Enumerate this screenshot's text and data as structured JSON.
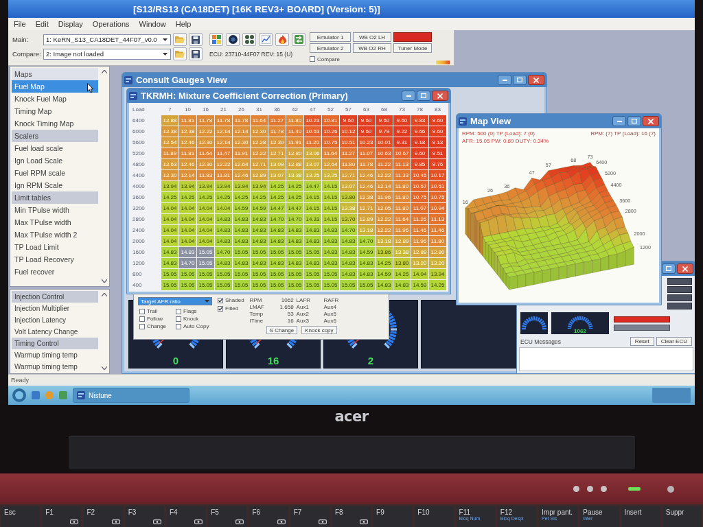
{
  "window": {
    "title": "[S13/RS13 (CA18DET) [16K REV3+ BOARD] (Version: 5)]"
  },
  "menu": [
    "File",
    "Edit",
    "Display",
    "Operations",
    "Window",
    "Help"
  ],
  "toolbar": {
    "main_label": "Main:",
    "main_image": "1: KeRN_S13_CA18DET_44F07_v0.0",
    "compare_label": "Compare:",
    "compare_image": "2: Image not loaded",
    "ecu": "ECU: 23710-44F07 REV: 15 (U)",
    "buttons": [
      {
        "kind": "button",
        "label": "Emulator 1"
      },
      {
        "kind": "button",
        "label": "WB O2 LH"
      },
      {
        "kind": "indicator"
      },
      {
        "kind": "button",
        "label": "Emulator 2"
      },
      {
        "kind": "button",
        "label": "WB O2 RH"
      },
      {
        "kind": "button",
        "label": "Tuner Mode"
      }
    ],
    "compare_checkbox": {
      "label": "Compare",
      "checked": false
    }
  },
  "sidebar": {
    "maps": [
      {
        "label": "Maps",
        "kind": "header",
        "selected": false
      },
      {
        "label": "Fuel Map",
        "kind": "item",
        "selected": true
      },
      {
        "label": "Knock Fuel Map",
        "kind": "item",
        "selected": false
      },
      {
        "label": "Timing Map",
        "kind": "item",
        "selected": false
      },
      {
        "label": "Knock Timing Map",
        "kind": "item",
        "selected": false
      },
      {
        "label": "Scalers",
        "kind": "group",
        "selected": false
      },
      {
        "label": "Fuel load scale",
        "kind": "item",
        "selected": false
      },
      {
        "label": "Ign Load Scale",
        "kind": "item",
        "selected": false
      },
      {
        "label": "Fuel RPM scale",
        "kind": "item",
        "selected": false
      },
      {
        "label": "Ign RPM Scale",
        "kind": "item",
        "selected": false
      },
      {
        "label": "Limit tables",
        "kind": "group",
        "selected": false
      },
      {
        "label": "Min TPulse width",
        "kind": "item",
        "selected": false
      },
      {
        "label": "Max TPulse width",
        "kind": "item",
        "selected": false
      },
      {
        "label": "Max TPulse width 2",
        "kind": "item",
        "selected": false
      },
      {
        "label": "TP Load Limit",
        "kind": "item",
        "selected": false
      },
      {
        "label": "TP Load Recovery",
        "kind": "item",
        "selected": false
      },
      {
        "label": "Fuel recover",
        "kind": "item",
        "selected": false
      }
    ],
    "controls": [
      {
        "label": "Injection Control",
        "kind": "group",
        "selected": false
      },
      {
        "label": "Injection Multiplier",
        "kind": "item",
        "selected": false
      },
      {
        "label": "Injection Latency",
        "kind": "item",
        "selected": false
      },
      {
        "label": "Volt Latency Change",
        "kind": "item",
        "selected": false
      },
      {
        "label": "Timing Control",
        "kind": "group",
        "selected": false
      },
      {
        "label": "Warmup timing temp",
        "kind": "item",
        "selected": false
      },
      {
        "label": "Warmup timing temp",
        "kind": "item",
        "selected": false
      }
    ],
    "status": "Ready"
  },
  "gauges_window": {
    "title": "Consult Gauges View",
    "gauges": [
      {
        "kind": "dial",
        "reading": "0"
      },
      {
        "kind": "dial",
        "reading": "16"
      },
      {
        "kind": "dial",
        "reading": "2"
      },
      {
        "kind": "blank"
      }
    ]
  },
  "mixture_window": {
    "title": "TKRMH: Mixture Coefficient Correction (Primary)",
    "corner": "Load",
    "columns": [
      "7",
      "10",
      "16",
      "21",
      "26",
      "31",
      "36",
      "42",
      "47",
      "52",
      "57",
      "63",
      "68",
      "73",
      "78",
      "83"
    ],
    "rows": [
      {
        "label": "6400",
        "cells": [
          {
            "value": "12.88",
            "selected": false
          },
          {
            "value": "11.81",
            "selected": false
          },
          {
            "value": "11.78",
            "selected": false
          },
          {
            "value": "11.78",
            "selected": false
          },
          {
            "value": "11.78",
            "selected": false
          },
          {
            "value": "11.64",
            "selected": false
          },
          {
            "value": "11.27",
            "selected": false
          },
          {
            "value": "11.80",
            "selected": false
          },
          {
            "value": "10.23",
            "selected": false
          },
          {
            "value": "10.81",
            "selected": false
          },
          {
            "value": "9.60",
            "selected": false
          },
          {
            "value": "9.60",
            "selected": false
          },
          {
            "value": "9.60",
            "selected": false
          },
          {
            "value": "9.60",
            "selected": false
          },
          {
            "value": "9.83",
            "selected": false
          },
          {
            "value": "9.60",
            "selected": false
          }
        ]
      },
      {
        "label": "6000",
        "cells": [
          {
            "value": "12.38",
            "selected": false
          },
          {
            "value": "12.38",
            "selected": false
          },
          {
            "value": "12.22",
            "selected": false
          },
          {
            "value": "12.14",
            "selected": false
          },
          {
            "value": "12.14",
            "selected": false
          },
          {
            "value": "12.30",
            "selected": false
          },
          {
            "value": "11.78",
            "selected": false
          },
          {
            "value": "11.40",
            "selected": false
          },
          {
            "value": "10.63",
            "selected": false
          },
          {
            "value": "10.26",
            "selected": false
          },
          {
            "value": "10.12",
            "selected": false
          },
          {
            "value": "9.60",
            "selected": false
          },
          {
            "value": "9.79",
            "selected": false
          },
          {
            "value": "9.22",
            "selected": false
          },
          {
            "value": "9.66",
            "selected": false
          },
          {
            "value": "9.60",
            "selected": false
          }
        ]
      },
      {
        "label": "5600",
        "cells": [
          {
            "value": "12.54",
            "selected": false
          },
          {
            "value": "12.46",
            "selected": false
          },
          {
            "value": "12.30",
            "selected": false
          },
          {
            "value": "12.14",
            "selected": false
          },
          {
            "value": "12.30",
            "selected": false
          },
          {
            "value": "12.28",
            "selected": false
          },
          {
            "value": "12.30",
            "selected": false
          },
          {
            "value": "11.91",
            "selected": false
          },
          {
            "value": "11.20",
            "selected": false
          },
          {
            "value": "10.75",
            "selected": false
          },
          {
            "value": "10.51",
            "selected": false
          },
          {
            "value": "10.23",
            "selected": false
          },
          {
            "value": "10.01",
            "selected": false
          },
          {
            "value": "9.31",
            "selected": false
          },
          {
            "value": "9.18",
            "selected": false
          },
          {
            "value": "9.13",
            "selected": false
          }
        ]
      },
      {
        "label": "5200",
        "cells": [
          {
            "value": "11.89",
            "selected": false
          },
          {
            "value": "11.81",
            "selected": false
          },
          {
            "value": "11.64",
            "selected": false
          },
          {
            "value": "11.47",
            "selected": false
          },
          {
            "value": "11.91",
            "selected": false
          },
          {
            "value": "12.22",
            "selected": false
          },
          {
            "value": "12.71",
            "selected": false
          },
          {
            "value": "12.80",
            "selected": false
          },
          {
            "value": "13.06",
            "selected": false
          },
          {
            "value": "11.64",
            "selected": false
          },
          {
            "value": "11.27",
            "selected": false
          },
          {
            "value": "11.07",
            "selected": false
          },
          {
            "value": "10.63",
            "selected": false
          },
          {
            "value": "10.67",
            "selected": false
          },
          {
            "value": "9.60",
            "selected": false
          },
          {
            "value": "9.51",
            "selected": false
          }
        ]
      },
      {
        "label": "4800",
        "cells": [
          {
            "value": "12.63",
            "selected": false
          },
          {
            "value": "12.46",
            "selected": false
          },
          {
            "value": "12.30",
            "selected": false
          },
          {
            "value": "12.22",
            "selected": false
          },
          {
            "value": "12.64",
            "selected": false
          },
          {
            "value": "12.71",
            "selected": false
          },
          {
            "value": "13.09",
            "selected": false
          },
          {
            "value": "12.88",
            "selected": false
          },
          {
            "value": "13.07",
            "selected": false
          },
          {
            "value": "12.64",
            "selected": false
          },
          {
            "value": "11.80",
            "selected": false
          },
          {
            "value": "11.78",
            "selected": false
          },
          {
            "value": "11.22",
            "selected": false
          },
          {
            "value": "11.13",
            "selected": false
          },
          {
            "value": "9.85",
            "selected": false
          },
          {
            "value": "9.76",
            "selected": false
          }
        ]
      },
      {
        "label": "4400",
        "cells": [
          {
            "value": "12.30",
            "selected": false
          },
          {
            "value": "12.14",
            "selected": false
          },
          {
            "value": "11.83",
            "selected": false
          },
          {
            "value": "11.81",
            "selected": false
          },
          {
            "value": "12.46",
            "selected": false
          },
          {
            "value": "12.89",
            "selected": false
          },
          {
            "value": "13.07",
            "selected": false
          },
          {
            "value": "13.38",
            "selected": false
          },
          {
            "value": "13.25",
            "selected": false
          },
          {
            "value": "13.25",
            "selected": false
          },
          {
            "value": "12.71",
            "selected": false
          },
          {
            "value": "12.46",
            "selected": false
          },
          {
            "value": "12.22",
            "selected": false
          },
          {
            "value": "11.33",
            "selected": false
          },
          {
            "value": "10.45",
            "selected": false
          },
          {
            "value": "10.17",
            "selected": false
          }
        ]
      },
      {
        "label": "4000",
        "cells": [
          {
            "value": "13.94",
            "selected": false
          },
          {
            "value": "13.94",
            "selected": false
          },
          {
            "value": "13.94",
            "selected": false
          },
          {
            "value": "13.94",
            "selected": false
          },
          {
            "value": "13.94",
            "selected": false
          },
          {
            "value": "13.94",
            "selected": false
          },
          {
            "value": "14.25",
            "selected": false
          },
          {
            "value": "14.25",
            "selected": false
          },
          {
            "value": "14.47",
            "selected": false
          },
          {
            "value": "14.15",
            "selected": false
          },
          {
            "value": "13.07",
            "selected": false
          },
          {
            "value": "12.46",
            "selected": false
          },
          {
            "value": "12.14",
            "selected": false
          },
          {
            "value": "11.80",
            "selected": false
          },
          {
            "value": "10.67",
            "selected": false
          },
          {
            "value": "10.51",
            "selected": false
          }
        ]
      },
      {
        "label": "3600",
        "cells": [
          {
            "value": "14.25",
            "selected": false
          },
          {
            "value": "14.25",
            "selected": false
          },
          {
            "value": "14.25",
            "selected": false
          },
          {
            "value": "14.25",
            "selected": false
          },
          {
            "value": "14.25",
            "selected": false
          },
          {
            "value": "14.25",
            "selected": false
          },
          {
            "value": "14.25",
            "selected": false
          },
          {
            "value": "14.25",
            "selected": false
          },
          {
            "value": "14.15",
            "selected": false
          },
          {
            "value": "14.15",
            "selected": false
          },
          {
            "value": "13.80",
            "selected": false
          },
          {
            "value": "12.38",
            "selected": false
          },
          {
            "value": "11.96",
            "selected": false
          },
          {
            "value": "11.80",
            "selected": false
          },
          {
            "value": "10.75",
            "selected": false
          },
          {
            "value": "10.75",
            "selected": false
          }
        ]
      },
      {
        "label": "3200",
        "cells": [
          {
            "value": "14.04",
            "selected": false
          },
          {
            "value": "14.04",
            "selected": false
          },
          {
            "value": "14.04",
            "selected": false
          },
          {
            "value": "14.04",
            "selected": false
          },
          {
            "value": "14.59",
            "selected": false
          },
          {
            "value": "14.59",
            "selected": false
          },
          {
            "value": "14.47",
            "selected": false
          },
          {
            "value": "14.47",
            "selected": false
          },
          {
            "value": "14.15",
            "selected": false
          },
          {
            "value": "14.15",
            "selected": false
          },
          {
            "value": "13.38",
            "selected": false
          },
          {
            "value": "12.71",
            "selected": false
          },
          {
            "value": "12.05",
            "selected": false
          },
          {
            "value": "11.80",
            "selected": false
          },
          {
            "value": "11.07",
            "selected": false
          },
          {
            "value": "10.94",
            "selected": false
          }
        ]
      },
      {
        "label": "2800",
        "cells": [
          {
            "value": "14.04",
            "selected": false
          },
          {
            "value": "14.04",
            "selected": false
          },
          {
            "value": "14.04",
            "selected": false
          },
          {
            "value": "14.83",
            "selected": false
          },
          {
            "value": "14.83",
            "selected": false
          },
          {
            "value": "14.83",
            "selected": false
          },
          {
            "value": "14.70",
            "selected": false
          },
          {
            "value": "14.70",
            "selected": false
          },
          {
            "value": "14.33",
            "selected": false
          },
          {
            "value": "14.15",
            "selected": false
          },
          {
            "value": "13.70",
            "selected": false
          },
          {
            "value": "12.89",
            "selected": false
          },
          {
            "value": "12.22",
            "selected": false
          },
          {
            "value": "11.64",
            "selected": false
          },
          {
            "value": "11.26",
            "selected": false
          },
          {
            "value": "11.13",
            "selected": false
          }
        ]
      },
      {
        "label": "2400",
        "cells": [
          {
            "value": "14.04",
            "selected": false
          },
          {
            "value": "14.04",
            "selected": false
          },
          {
            "value": "14.04",
            "selected": false
          },
          {
            "value": "14.83",
            "selected": false
          },
          {
            "value": "14.83",
            "selected": false
          },
          {
            "value": "14.83",
            "selected": false
          },
          {
            "value": "14.83",
            "selected": false
          },
          {
            "value": "14.83",
            "selected": false
          },
          {
            "value": "14.83",
            "selected": false
          },
          {
            "value": "14.83",
            "selected": false
          },
          {
            "value": "14.70",
            "selected": false
          },
          {
            "value": "13.18",
            "selected": false
          },
          {
            "value": "12.22",
            "selected": false
          },
          {
            "value": "11.96",
            "selected": false
          },
          {
            "value": "11.46",
            "selected": false
          },
          {
            "value": "11.46",
            "selected": false
          }
        ]
      },
      {
        "label": "2000",
        "cells": [
          {
            "value": "14.04",
            "selected": false
          },
          {
            "value": "14.04",
            "selected": false
          },
          {
            "value": "14.04",
            "selected": false
          },
          {
            "value": "14.83",
            "selected": false
          },
          {
            "value": "14.83",
            "selected": false
          },
          {
            "value": "14.83",
            "selected": false
          },
          {
            "value": "14.83",
            "selected": false
          },
          {
            "value": "14.83",
            "selected": false
          },
          {
            "value": "14.83",
            "selected": false
          },
          {
            "value": "14.83",
            "selected": false
          },
          {
            "value": "14.83",
            "selected": false
          },
          {
            "value": "14.70",
            "selected": false
          },
          {
            "value": "13.18",
            "selected": false
          },
          {
            "value": "12.89",
            "selected": false
          },
          {
            "value": "11.96",
            "selected": false
          },
          {
            "value": "11.80",
            "selected": false
          }
        ]
      },
      {
        "label": "1600",
        "cells": [
          {
            "value": "14.83",
            "selected": false
          },
          {
            "value": "14.83",
            "selected": true
          },
          {
            "value": "15.05",
            "selected": true
          },
          {
            "value": "14.70",
            "selected": false
          },
          {
            "value": "15.05",
            "selected": false
          },
          {
            "value": "15.05",
            "selected": false
          },
          {
            "value": "15.05",
            "selected": false
          },
          {
            "value": "15.05",
            "selected": false
          },
          {
            "value": "15.05",
            "selected": false
          },
          {
            "value": "14.83",
            "selected": false
          },
          {
            "value": "14.83",
            "selected": false
          },
          {
            "value": "14.59",
            "selected": false
          },
          {
            "value": "13.86",
            "selected": false
          },
          {
            "value": "13.38",
            "selected": false
          },
          {
            "value": "12.89",
            "selected": false
          },
          {
            "value": "12.80",
            "selected": false
          }
        ]
      },
      {
        "label": "1200",
        "cells": [
          {
            "value": "14.83",
            "selected": false
          },
          {
            "value": "14.70",
            "selected": true
          },
          {
            "value": "15.05",
            "selected": true
          },
          {
            "value": "14.83",
            "selected": false
          },
          {
            "value": "14.83",
            "selected": false
          },
          {
            "value": "14.83",
            "selected": false
          },
          {
            "value": "14.83",
            "selected": false
          },
          {
            "value": "14.83",
            "selected": false
          },
          {
            "value": "14.83",
            "selected": false
          },
          {
            "value": "14.83",
            "selected": false
          },
          {
            "value": "14.83",
            "selected": false
          },
          {
            "value": "14.83",
            "selected": false
          },
          {
            "value": "14.25",
            "selected": false
          },
          {
            "value": "13.80",
            "selected": false
          },
          {
            "value": "13.20",
            "selected": false
          },
          {
            "value": "13.20",
            "selected": false
          }
        ]
      },
      {
        "label": "800",
        "cells": [
          {
            "value": "15.05",
            "selected": false
          },
          {
            "value": "15.05",
            "selected": false
          },
          {
            "value": "15.05",
            "selected": false
          },
          {
            "value": "15.05",
            "selected": false
          },
          {
            "value": "15.05",
            "selected": false
          },
          {
            "value": "15.05",
            "selected": false
          },
          {
            "value": "15.05",
            "selected": false
          },
          {
            "value": "15.05",
            "selected": false
          },
          {
            "value": "15.05",
            "selected": false
          },
          {
            "value": "15.05",
            "selected": false
          },
          {
            "value": "14.83",
            "selected": false
          },
          {
            "value": "14.83",
            "selected": false
          },
          {
            "value": "14.59",
            "selected": false
          },
          {
            "value": "14.25",
            "selected": false
          },
          {
            "value": "14.04",
            "selected": false
          },
          {
            "value": "13.94",
            "selected": false
          }
        ]
      },
      {
        "label": "400",
        "cells": [
          {
            "value": "15.05",
            "selected": false
          },
          {
            "value": "15.05",
            "selected": false
          },
          {
            "value": "15.05",
            "selected": false
          },
          {
            "value": "15.05",
            "selected": false
          },
          {
            "value": "15.05",
            "selected": false
          },
          {
            "value": "15.05",
            "selected": false
          },
          {
            "value": "15.05",
            "selected": false
          },
          {
            "value": "15.05",
            "selected": false
          },
          {
            "value": "15.05",
            "selected": false
          },
          {
            "value": "15.05",
            "selected": false
          },
          {
            "value": "15.05",
            "selected": false
          },
          {
            "value": "15.05",
            "selected": false
          },
          {
            "value": "14.83",
            "selected": false
          },
          {
            "value": "14.83",
            "selected": false
          },
          {
            "value": "14.59",
            "selected": false
          },
          {
            "value": "14.25",
            "selected": false
          }
        ]
      }
    ]
  },
  "ecu_window": {
    "small_gauges": [
      {
        "kind": "dial"
      },
      {
        "kind": "dial",
        "reading": "1062"
      }
    ],
    "messages_label": "ECU Messages",
    "buttons": [
      "Reset",
      "Clear ECU"
    ]
  },
  "map_view": {
    "title": "Map View",
    "info_left": [
      "RPM: 500 (0) TP (Load): 7 (0)",
      "AFR: 15.05 PW: 0.89 DUTY: 0.34%"
    ],
    "info_right": "RPM: (7) TP (Load): 16 (7)",
    "load_axis": [
      "16",
      "26",
      "36",
      "47",
      "57",
      "68",
      "73"
    ],
    "rpm_axis": [
      "6400",
      "5200",
      "4400",
      "3600",
      "2800",
      "2000",
      "1200"
    ]
  },
  "options_panel": {
    "dropdown": "Target AFR ratio",
    "checkbox_columns": [
      [
        {
          "label": "Trail",
          "checked": false
        },
        {
          "label": "Follow",
          "checked": false
        },
        {
          "label": "Change",
          "checked": false
        }
      ],
      [
        {
          "label": "Flags",
          "checked": false
        },
        {
          "label": "Knock",
          "checked": false
        },
        {
          "label": "Auto Copy",
          "checked": false
        }
      ]
    ],
    "view_options": [
      {
        "label": "Shaded",
        "checked": true
      },
      {
        "label": "Filled",
        "checked": true
      }
    ],
    "readouts": [
      {
        "name": "RPM",
        "value": "1062",
        "aux_left": "LAFR",
        "aux_right": "RAFR"
      },
      {
        "name": "LMAF",
        "value": "1.658",
        "aux_left": "Aux1",
        "aux_right": "Aux4"
      },
      {
        "name": "Temp",
        "value": "53",
        "aux_left": "Aux2",
        "aux_right": "Aux5"
      },
      {
        "name": "ITime",
        "value": "16",
        "aux_left": "Aux3",
        "aux_right": "Aux6"
      }
    ],
    "buttons": [
      "S Change",
      "Knock copy"
    ]
  },
  "taskbar": {
    "tasks": [
      {
        "label": "Nistune",
        "selected": true
      }
    ]
  },
  "laptop": {
    "logo": "acer",
    "keys": [
      {
        "label": "Esc",
        "kind": "plain"
      },
      {
        "label": "F1",
        "kind": "fn"
      },
      {
        "label": "F2",
        "kind": "fn"
      },
      {
        "label": "F3",
        "kind": "fn"
      },
      {
        "label": "F4",
        "kind": "fn"
      },
      {
        "label": "F5",
        "kind": "fn"
      },
      {
        "label": "F6",
        "kind": "fn"
      },
      {
        "label": "F7",
        "kind": "fn"
      },
      {
        "label": "F8",
        "kind": "fn"
      },
      {
        "label": "F9",
        "kind": "plain"
      },
      {
        "label": "F10",
        "kind": "plain"
      },
      {
        "label": "F11",
        "kind": "sub",
        "sub": "Bloq Num"
      },
      {
        "label": "F12",
        "kind": "sub",
        "sub": "Bloq Despl"
      },
      {
        "label": "Impr pant.",
        "kind": "sub",
        "sub": "Pet Sis"
      },
      {
        "label": "Pause",
        "kind": "sub",
        "sub": "Inter"
      },
      {
        "label": "Insert",
        "kind": "plain"
      },
      {
        "label": "Suppr",
        "kind": "plain"
      }
    ]
  }
}
